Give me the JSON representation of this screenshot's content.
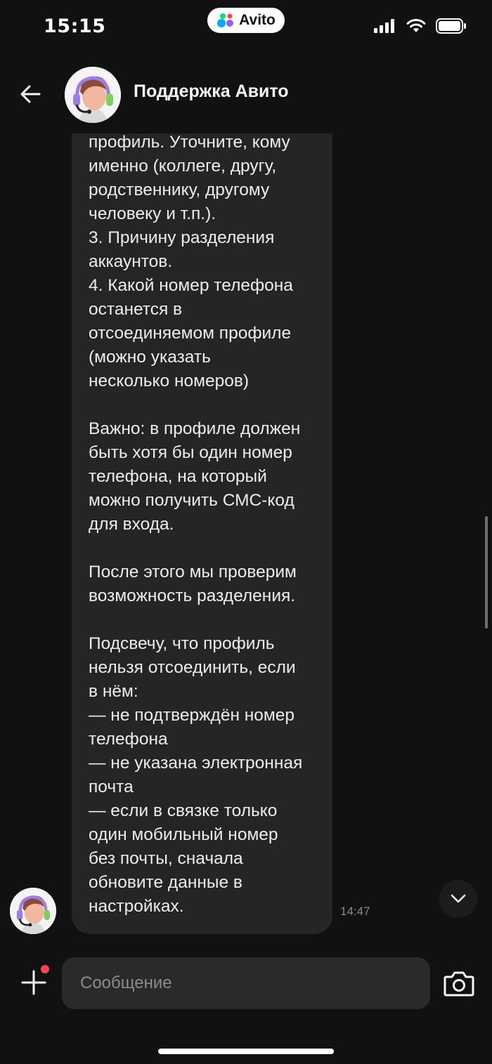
{
  "status_bar": {
    "time": "15:15",
    "app_pill": "Avito",
    "icons": [
      "signal-icon",
      "wifi-icon",
      "battery-icon"
    ]
  },
  "header": {
    "title": "Поддержка Авито",
    "back_icon": "back-arrow-icon"
  },
  "message": {
    "text": "…ому принадлежит второй\nпрофиль. Уточните, кому\nименно (коллеге, другу,\nродственнику, другому\nчеловеку и т.п.).\n3. Причину разделения\nаккаунтов.\n4. Какой номер телефона\nостанется в\nотсоединяемом профиле\n(можно указать\nнесколько номеров)\n\nВажно: в профиле должен\nбыть хотя бы один номер\nтелефона, на который\nможно получить СМС-код\nдля входа.\n\nПосле этого мы проверим\nвозможность разделения.\n\nПодсвечу, что профиль\nнельзя отсоединить, если\nв нём:\n— не подтверждён номер\nтелефона\n— не указана электронная\nпочта\n— если в связке только\nодин мобильный номер\nбез почты, сначала\nобновите данные в\nнастройках.",
    "time": "14:47"
  },
  "input": {
    "placeholder": "Сообщение"
  },
  "colors": {
    "background": "#111111",
    "bubble": "#252525",
    "input_bg": "#2a2a2a",
    "badge": "#ff4053"
  }
}
